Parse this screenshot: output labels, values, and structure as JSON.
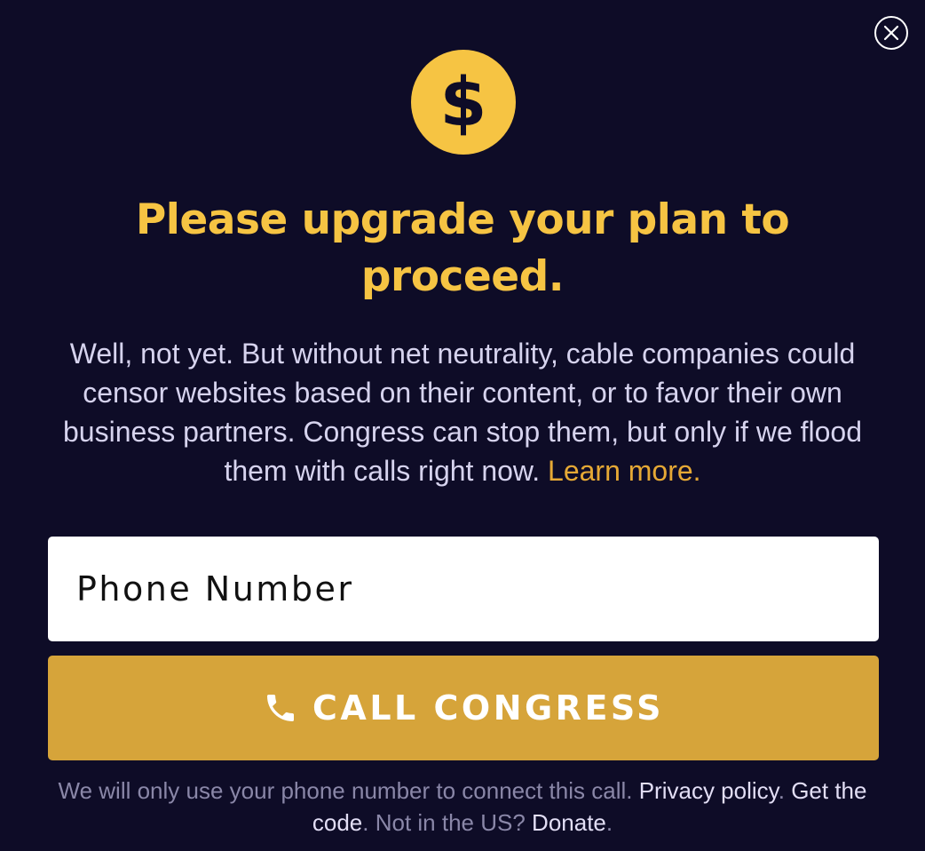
{
  "close": {
    "icon": "close-icon"
  },
  "coin": {
    "icon": "dollar-icon",
    "symbol": "$"
  },
  "headline": "Please upgrade your plan to proceed.",
  "body": {
    "text": "Well, not yet. But without net neutrality, cable companies could censor websites based on their content, or to favor their own business partners. Congress can stop them, but only if we flood them with calls right now.",
    "learn_more": "Learn more."
  },
  "form": {
    "phone_placeholder": "Phone Number",
    "phone_value": "",
    "call_label": "CALL CONGRESS",
    "call_icon": "phone-icon"
  },
  "footer": {
    "notice": "We will only use your phone number to connect this call.",
    "privacy_link": "Privacy policy",
    "get_code_link": "Get the code",
    "not_us": "Not in the US?",
    "donate_link": "Donate"
  },
  "colors": {
    "background": "#0e0c27",
    "accent_yellow": "#f6c443",
    "button_gold": "#d6a43a",
    "link_orange": "#e6a935"
  }
}
